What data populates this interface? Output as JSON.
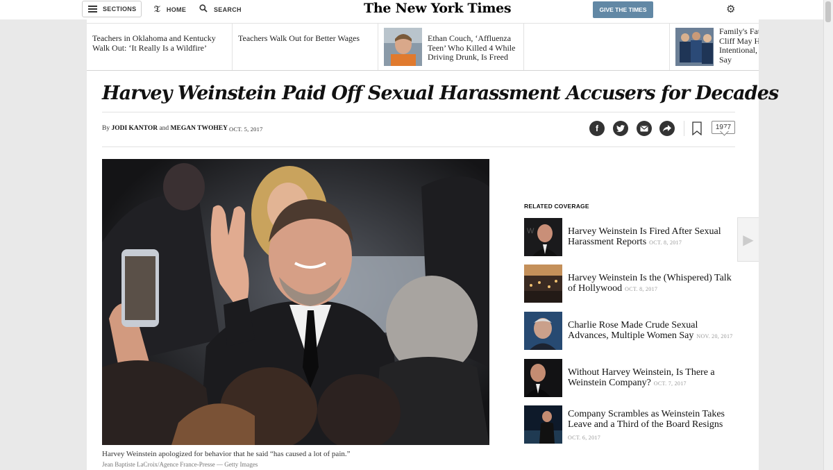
{
  "masthead": {
    "sections_label": "SECTIONS",
    "home_label": "HOME",
    "search_label": "SEARCH",
    "logo": "The New York Times",
    "give_label": "GIVE THE TIMES"
  },
  "ribbon": {
    "items": [
      {
        "title": "Teachers in Oklahoma and Kentucky Walk Out: ‘It Really Is a Wildfire’"
      },
      {
        "title": "Teachers Walk Out for Better Wages"
      },
      {
        "title": "Ethan Couch, ‘Affluenza Teen’ Who Killed 4 While Driving Drunk, Is Freed"
      },
      {
        "title": "Family's Fat... Cliff May H... Intentional,... Say"
      }
    ]
  },
  "article": {
    "headline": "Harvey Weinstein Paid Off Sexual Harassment Accusers for Decades",
    "by": "By",
    "author1": "JODI KANTOR",
    "and": "and",
    "author2": "MEGAN TWOHEY",
    "date": "OCT. 5, 2017",
    "comment_count": "1977",
    "caption": "Harvey Weinstein apologized for behavior that he said “has caused a lot of pain.”",
    "credit": "Jean Baptiste LaCroix/Agence France-Presse — Getty Images"
  },
  "share": {
    "facebook": "f",
    "twitter": "t",
    "email": "✉",
    "more": "➦"
  },
  "related": {
    "heading": "RELATED COVERAGE",
    "items": [
      {
        "title": "Harvey Weinstein Is Fired After Sexual Harassment Reports",
        "date": "OCT. 8, 2017"
      },
      {
        "title": "Harvey Weinstein Is the (Whispered) Talk of Hollywood",
        "date": "OCT. 8, 2017"
      },
      {
        "title": "Charlie Rose Made Crude Sexual Advances, Multiple Women Say",
        "date": "NOV. 20, 2017"
      },
      {
        "title": "Without Harvey Weinstein, Is There a Weinstein Company?",
        "date": "OCT. 7, 2017"
      },
      {
        "title": "Company Scrambles as Weinstein Takes Leave and a Third of the Board Resigns",
        "date": "OCT. 6, 2017"
      }
    ]
  },
  "icons": [
    "hamburger-icon",
    "home-icon",
    "search-icon",
    "gear-icon",
    "facebook-icon",
    "twitter-icon",
    "email-icon",
    "share-icon",
    "bookmark-icon",
    "comment-icon",
    "next-arrow-icon"
  ]
}
